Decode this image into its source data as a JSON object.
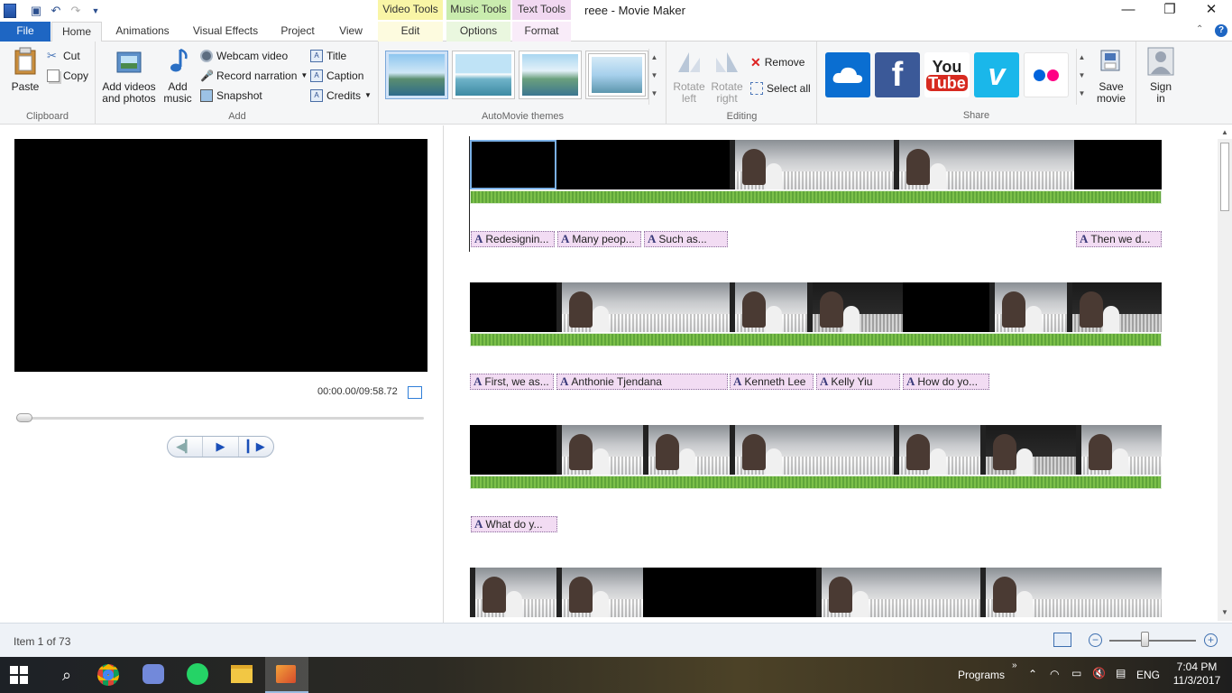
{
  "window": {
    "title": "reee - Movie Maker",
    "contextual_tabs": {
      "video_tools": "Video Tools",
      "music_tools": "Music Tools",
      "text_tools": "Text Tools"
    },
    "controls": {
      "minimize": "—",
      "restore": "❐",
      "close": "✕"
    }
  },
  "tabs": {
    "file": "File",
    "home": "Home",
    "animations": "Animations",
    "visual_effects": "Visual Effects",
    "project": "Project",
    "view": "View",
    "edit": "Edit",
    "options": "Options",
    "format": "Format"
  },
  "ribbon": {
    "clipboard": {
      "label": "Clipboard",
      "paste": "Paste",
      "cut": "Cut",
      "copy": "Copy"
    },
    "add": {
      "label": "Add",
      "add_videos_line1": "Add videos",
      "add_videos_line2": "and photos",
      "add_music_line1": "Add",
      "add_music_line2": "music",
      "webcam": "Webcam video",
      "narration": "Record narration",
      "snapshot": "Snapshot",
      "title": "Title",
      "caption": "Caption",
      "credits": "Credits"
    },
    "themes": {
      "label": "AutoMovie themes"
    },
    "editing": {
      "label": "Editing",
      "rotate_left_1": "Rotate",
      "rotate_left_2": "left",
      "rotate_right_1": "Rotate",
      "rotate_right_2": "right",
      "remove": "Remove",
      "select_all": "Select all"
    },
    "share": {
      "label": "Share",
      "save_movie_1": "Save",
      "save_movie_2": "movie",
      "sign_in_1": "Sign",
      "sign_in_2": "in",
      "youtube_1": "You",
      "youtube_2": "Tube"
    }
  },
  "preview": {
    "timecode": "00:00.00/09:58.72",
    "seek_position": 0.0
  },
  "storyboard": {
    "captions_row1": [
      "Redesignin...",
      "Many peop...",
      "Such as...",
      "Then we d..."
    ],
    "captions_row2": [
      "First, we as...",
      "Anthonie Tjendana",
      "Kenneth Lee",
      "Kelly Yiu",
      "How do yo..."
    ],
    "captions_row3": [
      "What do y..."
    ]
  },
  "status": {
    "text": "Item 1 of 73",
    "zoom_minus": "−",
    "zoom_plus": "+",
    "zoom_level": 0.4
  },
  "taskbar": {
    "programs": "Programs",
    "language": "ENG",
    "time": "7:04 PM",
    "date": "11/3/2017"
  },
  "colors": {
    "file_tab": "#1e66c3",
    "video_tools": "#f9f5a6",
    "music_tools": "#c9ecae",
    "text_tools": "#f1d8f1",
    "caption_bg": "#f2dcf3",
    "audio_green": "#6cb43f"
  }
}
